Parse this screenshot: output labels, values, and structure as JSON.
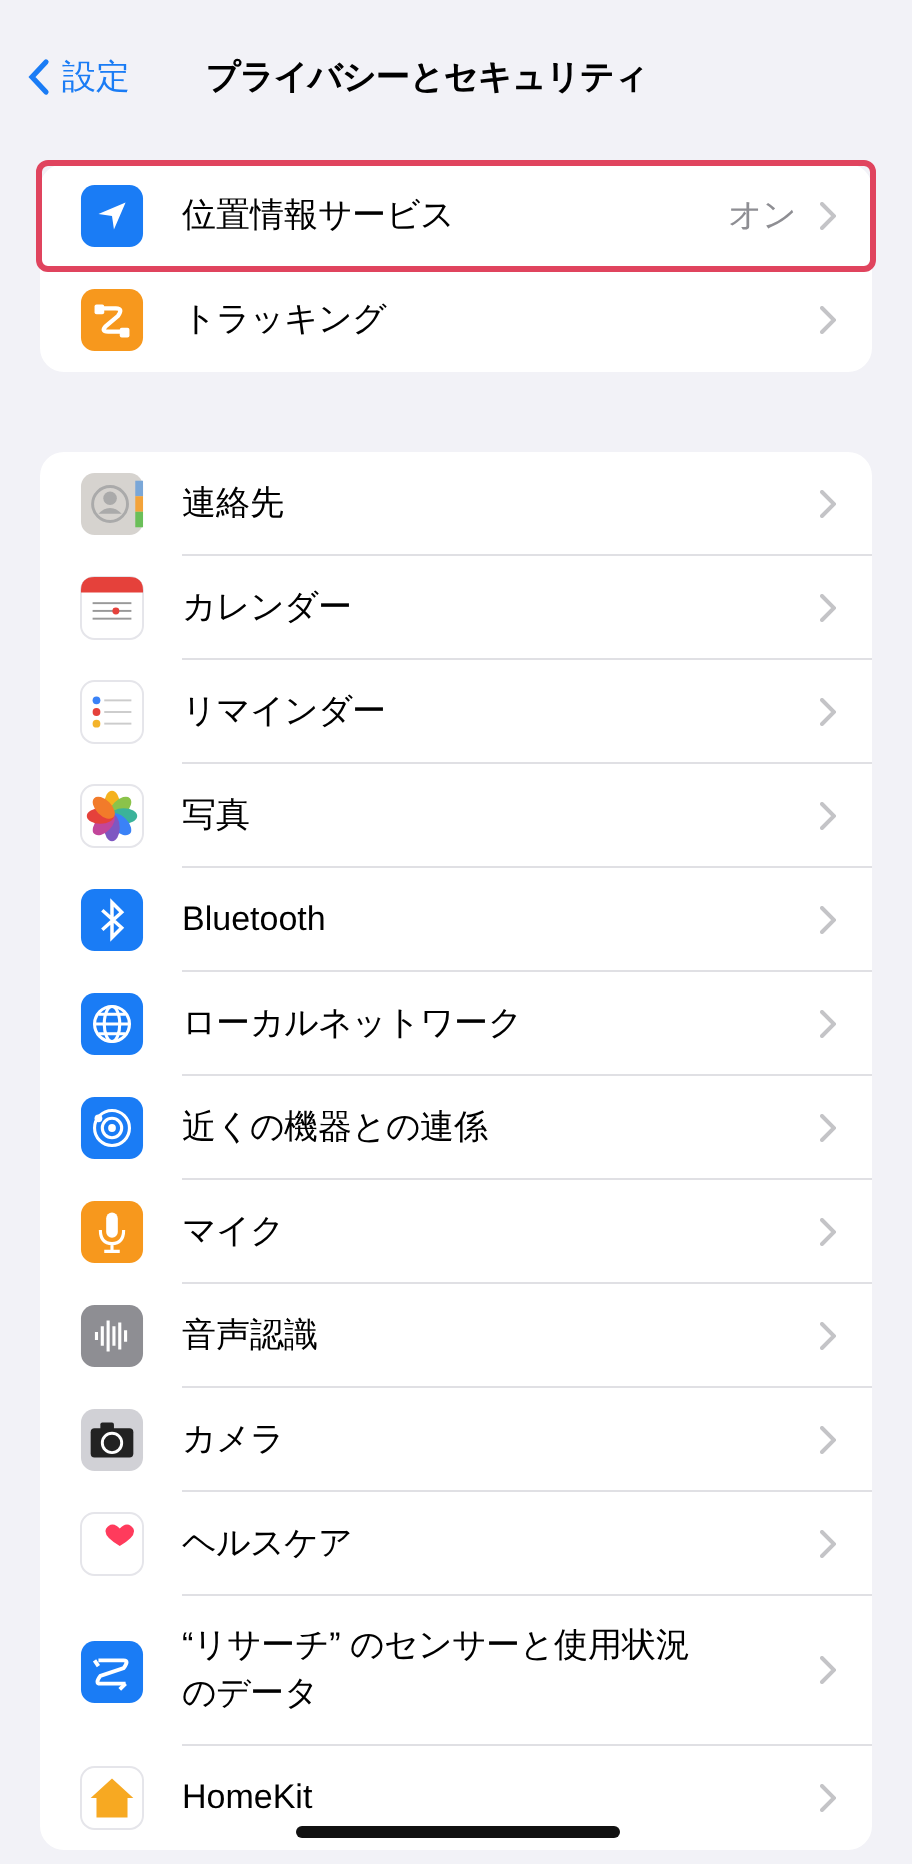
{
  "nav": {
    "back": "設定",
    "title": "プライバシーとセキュリティ"
  },
  "groups": [
    {
      "items": [
        {
          "label": "位置情報サービス",
          "value": "オン",
          "highlighted": true
        },
        {
          "label": "トラッキング",
          "highlighted": false
        }
      ]
    },
    {
      "items": [
        {
          "label": "連絡先"
        },
        {
          "label": "カレンダー"
        },
        {
          "label": "リマインダー"
        },
        {
          "label": "写真"
        },
        {
          "label": "Bluetooth"
        },
        {
          "label": "ローカルネットワーク"
        },
        {
          "label": "近くの機器との連係"
        },
        {
          "label": "マイク"
        },
        {
          "label": "音声認識"
        },
        {
          "label": "カメラ"
        },
        {
          "label": "ヘルスケア"
        },
        {
          "label": "“リサーチ” のセンサーと使用状況のデータ"
        },
        {
          "label": "HomeKit"
        }
      ]
    }
  ]
}
